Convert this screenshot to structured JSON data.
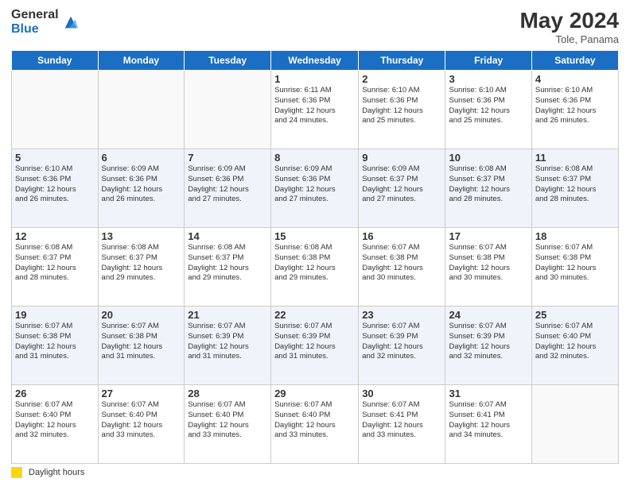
{
  "logo": {
    "general": "General",
    "blue": "Blue"
  },
  "title": "May 2024",
  "subtitle": "Tole, Panama",
  "days_of_week": [
    "Sunday",
    "Monday",
    "Tuesday",
    "Wednesday",
    "Thursday",
    "Friday",
    "Saturday"
  ],
  "footer": {
    "legend_label": "Daylight hours"
  },
  "weeks": [
    [
      {
        "day": "",
        "info": ""
      },
      {
        "day": "",
        "info": ""
      },
      {
        "day": "",
        "info": ""
      },
      {
        "day": "1",
        "info": "Sunrise: 6:11 AM\nSunset: 6:36 PM\nDaylight: 12 hours\nand 24 minutes."
      },
      {
        "day": "2",
        "info": "Sunrise: 6:10 AM\nSunset: 6:36 PM\nDaylight: 12 hours\nand 25 minutes."
      },
      {
        "day": "3",
        "info": "Sunrise: 6:10 AM\nSunset: 6:36 PM\nDaylight: 12 hours\nand 25 minutes."
      },
      {
        "day": "4",
        "info": "Sunrise: 6:10 AM\nSunset: 6:36 PM\nDaylight: 12 hours\nand 26 minutes."
      }
    ],
    [
      {
        "day": "5",
        "info": "Sunrise: 6:10 AM\nSunset: 6:36 PM\nDaylight: 12 hours\nand 26 minutes."
      },
      {
        "day": "6",
        "info": "Sunrise: 6:09 AM\nSunset: 6:36 PM\nDaylight: 12 hours\nand 26 minutes."
      },
      {
        "day": "7",
        "info": "Sunrise: 6:09 AM\nSunset: 6:36 PM\nDaylight: 12 hours\nand 27 minutes."
      },
      {
        "day": "8",
        "info": "Sunrise: 6:09 AM\nSunset: 6:36 PM\nDaylight: 12 hours\nand 27 minutes."
      },
      {
        "day": "9",
        "info": "Sunrise: 6:09 AM\nSunset: 6:37 PM\nDaylight: 12 hours\nand 27 minutes."
      },
      {
        "day": "10",
        "info": "Sunrise: 6:08 AM\nSunset: 6:37 PM\nDaylight: 12 hours\nand 28 minutes."
      },
      {
        "day": "11",
        "info": "Sunrise: 6:08 AM\nSunset: 6:37 PM\nDaylight: 12 hours\nand 28 minutes."
      }
    ],
    [
      {
        "day": "12",
        "info": "Sunrise: 6:08 AM\nSunset: 6:37 PM\nDaylight: 12 hours\nand 28 minutes."
      },
      {
        "day": "13",
        "info": "Sunrise: 6:08 AM\nSunset: 6:37 PM\nDaylight: 12 hours\nand 29 minutes."
      },
      {
        "day": "14",
        "info": "Sunrise: 6:08 AM\nSunset: 6:37 PM\nDaylight: 12 hours\nand 29 minutes."
      },
      {
        "day": "15",
        "info": "Sunrise: 6:08 AM\nSunset: 6:38 PM\nDaylight: 12 hours\nand 29 minutes."
      },
      {
        "day": "16",
        "info": "Sunrise: 6:07 AM\nSunset: 6:38 PM\nDaylight: 12 hours\nand 30 minutes."
      },
      {
        "day": "17",
        "info": "Sunrise: 6:07 AM\nSunset: 6:38 PM\nDaylight: 12 hours\nand 30 minutes."
      },
      {
        "day": "18",
        "info": "Sunrise: 6:07 AM\nSunset: 6:38 PM\nDaylight: 12 hours\nand 30 minutes."
      }
    ],
    [
      {
        "day": "19",
        "info": "Sunrise: 6:07 AM\nSunset: 6:38 PM\nDaylight: 12 hours\nand 31 minutes."
      },
      {
        "day": "20",
        "info": "Sunrise: 6:07 AM\nSunset: 6:38 PM\nDaylight: 12 hours\nand 31 minutes."
      },
      {
        "day": "21",
        "info": "Sunrise: 6:07 AM\nSunset: 6:39 PM\nDaylight: 12 hours\nand 31 minutes."
      },
      {
        "day": "22",
        "info": "Sunrise: 6:07 AM\nSunset: 6:39 PM\nDaylight: 12 hours\nand 31 minutes."
      },
      {
        "day": "23",
        "info": "Sunrise: 6:07 AM\nSunset: 6:39 PM\nDaylight: 12 hours\nand 32 minutes."
      },
      {
        "day": "24",
        "info": "Sunrise: 6:07 AM\nSunset: 6:39 PM\nDaylight: 12 hours\nand 32 minutes."
      },
      {
        "day": "25",
        "info": "Sunrise: 6:07 AM\nSunset: 6:40 PM\nDaylight: 12 hours\nand 32 minutes."
      }
    ],
    [
      {
        "day": "26",
        "info": "Sunrise: 6:07 AM\nSunset: 6:40 PM\nDaylight: 12 hours\nand 32 minutes."
      },
      {
        "day": "27",
        "info": "Sunrise: 6:07 AM\nSunset: 6:40 PM\nDaylight: 12 hours\nand 33 minutes."
      },
      {
        "day": "28",
        "info": "Sunrise: 6:07 AM\nSunset: 6:40 PM\nDaylight: 12 hours\nand 33 minutes."
      },
      {
        "day": "29",
        "info": "Sunrise: 6:07 AM\nSunset: 6:40 PM\nDaylight: 12 hours\nand 33 minutes."
      },
      {
        "day": "30",
        "info": "Sunrise: 6:07 AM\nSunset: 6:41 PM\nDaylight: 12 hours\nand 33 minutes."
      },
      {
        "day": "31",
        "info": "Sunrise: 6:07 AM\nSunset: 6:41 PM\nDaylight: 12 hours\nand 34 minutes."
      },
      {
        "day": "",
        "info": ""
      }
    ]
  ]
}
